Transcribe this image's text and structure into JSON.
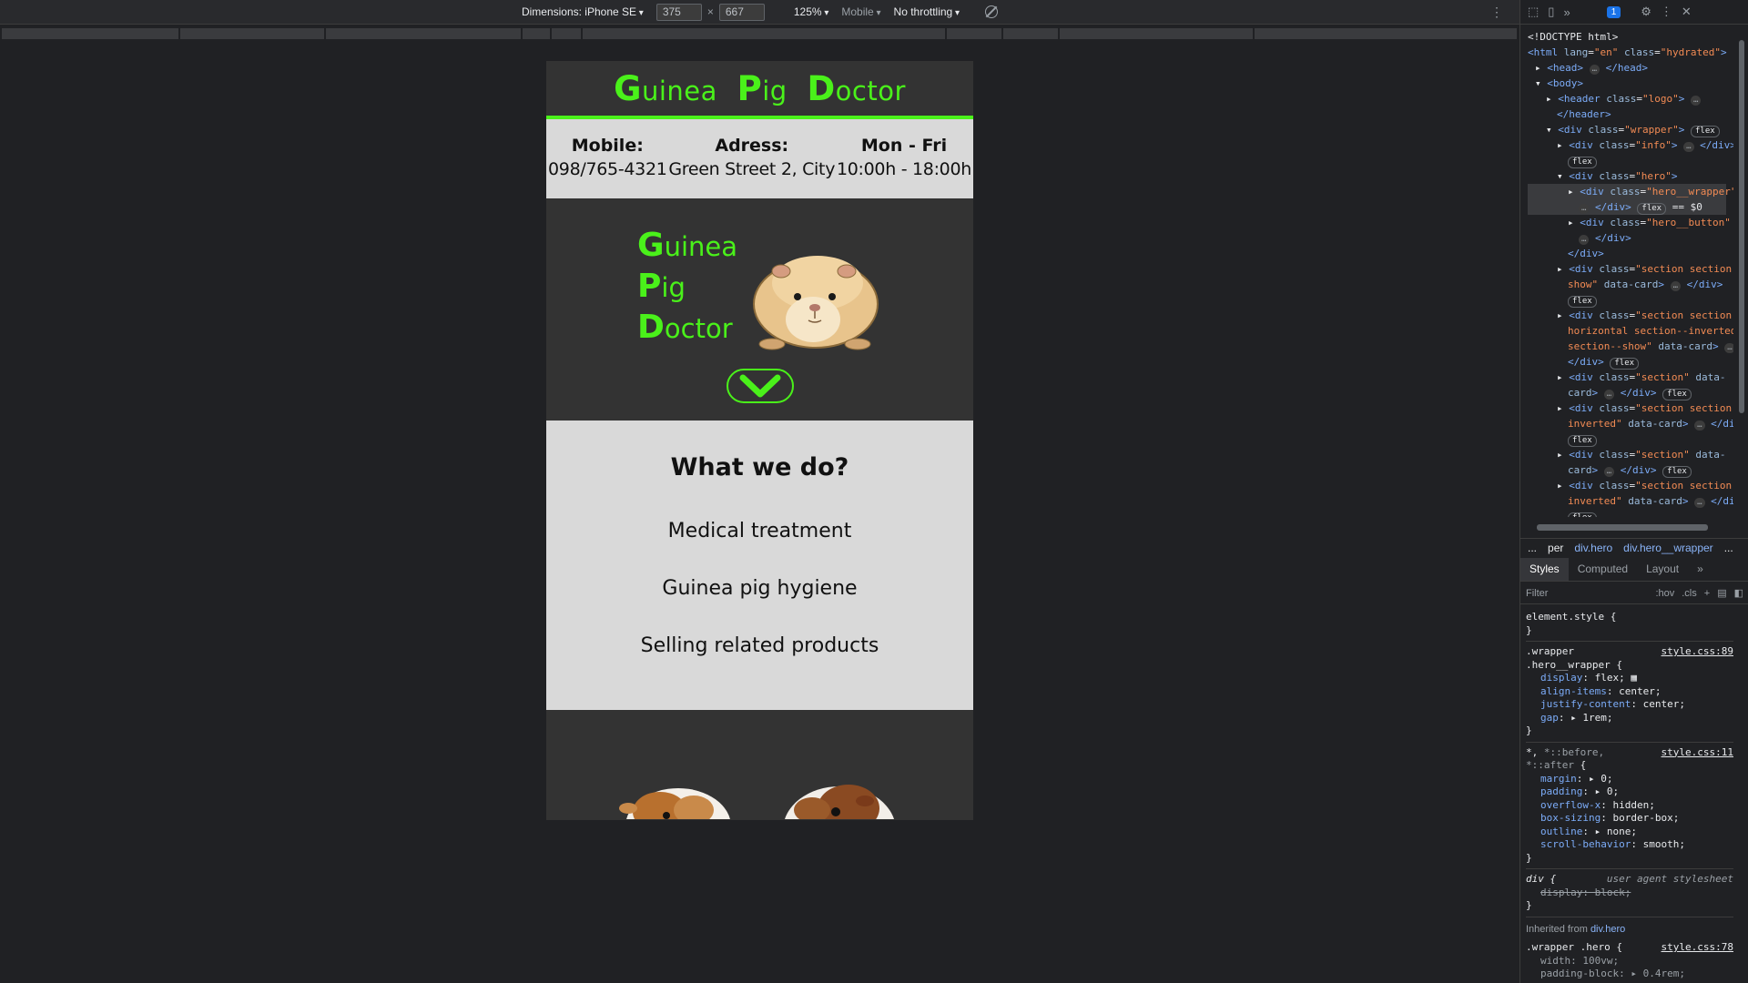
{
  "toolbar": {
    "dimensions_label": "Dimensions: iPhone SE",
    "width": "375",
    "times": "×",
    "height": "667",
    "zoom": "125%",
    "mode": "Mobile",
    "throttling": "No throttling"
  },
  "site": {
    "logo": {
      "g": "G",
      "uinea": "uinea",
      "p": "P",
      "ig": "ig",
      "d": "D",
      "octor": "octor"
    },
    "info": [
      {
        "label": "Mobile:",
        "value": "098/765-4321"
      },
      {
        "label": "Adress:",
        "value": "Green Street 2, City"
      },
      {
        "label": "Mon - Fri",
        "value": "10:00h - 18:00h"
      }
    ],
    "hero": {
      "g": "G",
      "uinea": "uinea",
      "p": "P",
      "ig": "ig",
      "d": "D",
      "octor": "octor"
    },
    "section": {
      "title": "What we do?",
      "items": [
        "Medical treatment",
        "Guinea pig hygiene",
        "Selling related products"
      ]
    },
    "colors": {
      "accent": "#4af11a",
      "dark": "#333333",
      "light": "#d9d9d9"
    }
  },
  "devtools": {
    "issues_count": "1",
    "crumbs": [
      "...",
      "per",
      "div.hero",
      "div.hero__wrapper",
      "..."
    ],
    "tabs": [
      "Styles",
      "Computed",
      "Layout",
      "»"
    ],
    "filter_placeholder": "Filter",
    "hov": ":hov",
    "cls": ".cls",
    "inherited_label": "Inherited from",
    "inherited_from": "div.hero"
  }
}
